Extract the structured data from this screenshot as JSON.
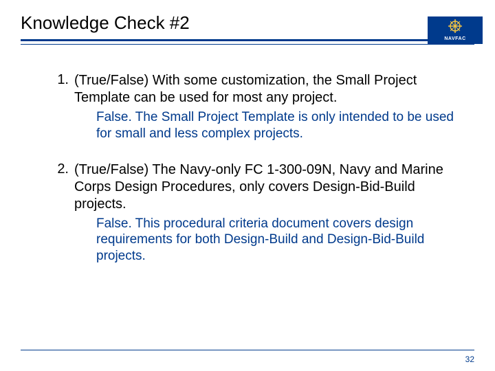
{
  "header": {
    "title": "Knowledge Check #2",
    "logo_text": "NAVFAC"
  },
  "questions": [
    {
      "number": "1.",
      "text": "(True/False) With some customization, the Small Project Template can be used for most any project.",
      "answer": "False. The Small Project Template is only intended to be used for small and less complex projects."
    },
    {
      "number": "2.",
      "text": "(True/False) The Navy-only FC 1-300-09N, Navy and Marine Corps Design Procedures, only covers Design-Bid-Build projects.",
      "answer": "False. This procedural criteria document covers design requirements for both Design-Build and Design-Bid-Build projects."
    }
  ],
  "footer": {
    "page_number": "32"
  }
}
